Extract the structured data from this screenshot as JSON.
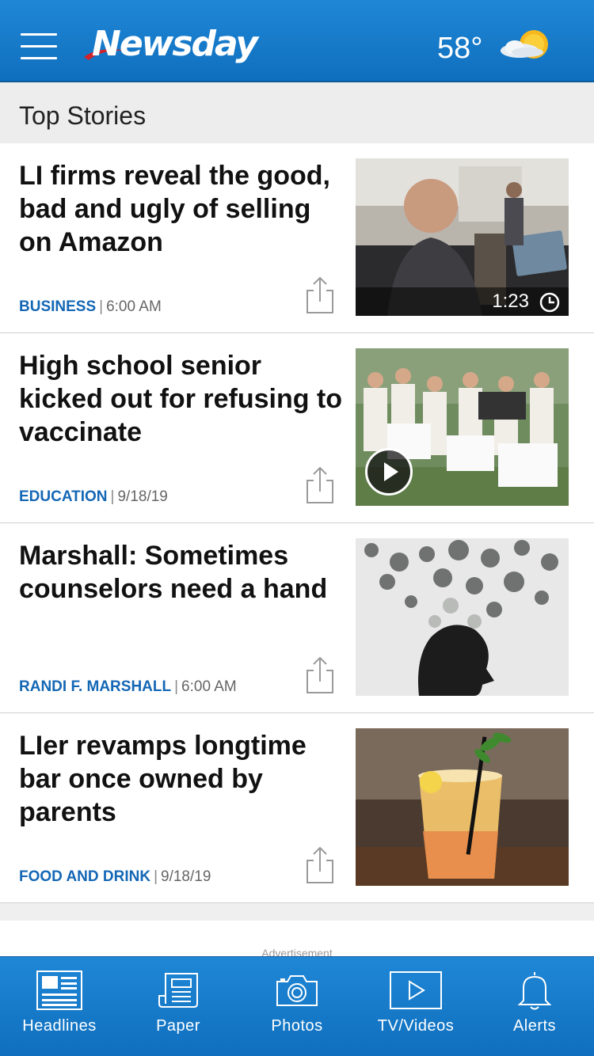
{
  "header": {
    "logo_text": "Newsday",
    "temperature": "58°",
    "weather_icon": "partly-sunny-icon"
  },
  "section": {
    "title": "Top Stories"
  },
  "stories": [
    {
      "headline": "LI firms reveal the good, bad and ugly of selling on Amazon",
      "category": "BUSINESS",
      "time": "6:00 AM",
      "video_duration": "1:23"
    },
    {
      "headline": "High school senior kicked out for refusing to vaccinate",
      "category": "EDUCATION",
      "time": "9/18/19"
    },
    {
      "headline": "Marshall: Sometimes counselors need a hand",
      "category": "RANDI F. MARSHALL",
      "time": "6:00 AM"
    },
    {
      "headline": "LIer revamps longtime bar once owned by parents",
      "category": "FOOD AND DRINK",
      "time": "9/18/19"
    }
  ],
  "ad_label": "Advertisement",
  "tabs": [
    {
      "label": "Headlines",
      "icon": "headlines-icon"
    },
    {
      "label": "Paper",
      "icon": "paper-icon"
    },
    {
      "label": "Photos",
      "icon": "camera-icon"
    },
    {
      "label": "TV/Videos",
      "icon": "play-icon"
    },
    {
      "label": "Alerts",
      "icon": "bell-icon"
    }
  ],
  "colors": {
    "brand_blue": "#1467b5",
    "header_blue": "#1a7fd0"
  }
}
